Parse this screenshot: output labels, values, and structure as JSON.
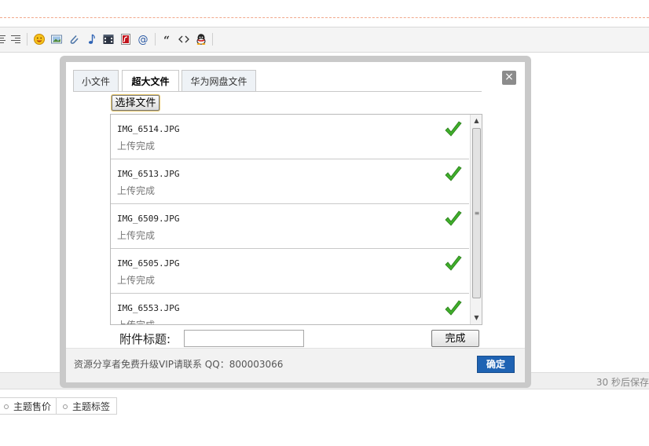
{
  "dialog": {
    "tabs": [
      {
        "label": "小文件"
      },
      {
        "label": "超大文件",
        "active": true
      },
      {
        "label": "华为网盘文件"
      }
    ],
    "close_symbol": "×",
    "choose_button": "选择文件",
    "files": [
      {
        "name": "IMG_6514.JPG",
        "status": "上传完成"
      },
      {
        "name": "IMG_6513.JPG",
        "status": "上传完成"
      },
      {
        "name": "IMG_6509.JPG",
        "status": "上传完成"
      },
      {
        "name": "IMG_6505.JPG",
        "status": "上传完成"
      },
      {
        "name": "IMG_6553.JPG",
        "status": "上传完成"
      }
    ],
    "attachment_label": "附件标题:",
    "attachment_value": "",
    "done_button": "完成",
    "footer_text": "资源分享者免费升级VIP请联系 QQ：800003066",
    "confirm_button": "确定"
  },
  "toolbar": {
    "icons": [
      "align-center-icon",
      "align-right-icon",
      "smiley-icon",
      "image-icon",
      "attachment-icon",
      "music-icon",
      "video-icon",
      "flash-icon",
      "at-icon",
      "quote-icon",
      "code-icon",
      "qq-icon"
    ]
  },
  "status_bar": {
    "autosave_text": "30 秒后保存"
  },
  "bottom_buttons": [
    {
      "label": "主题售价"
    },
    {
      "label": "主题标签"
    }
  ],
  "colors": {
    "accent": "#1f63b3",
    "check_green": "#3fae2a",
    "dialog_border": "#c9c9c9"
  }
}
